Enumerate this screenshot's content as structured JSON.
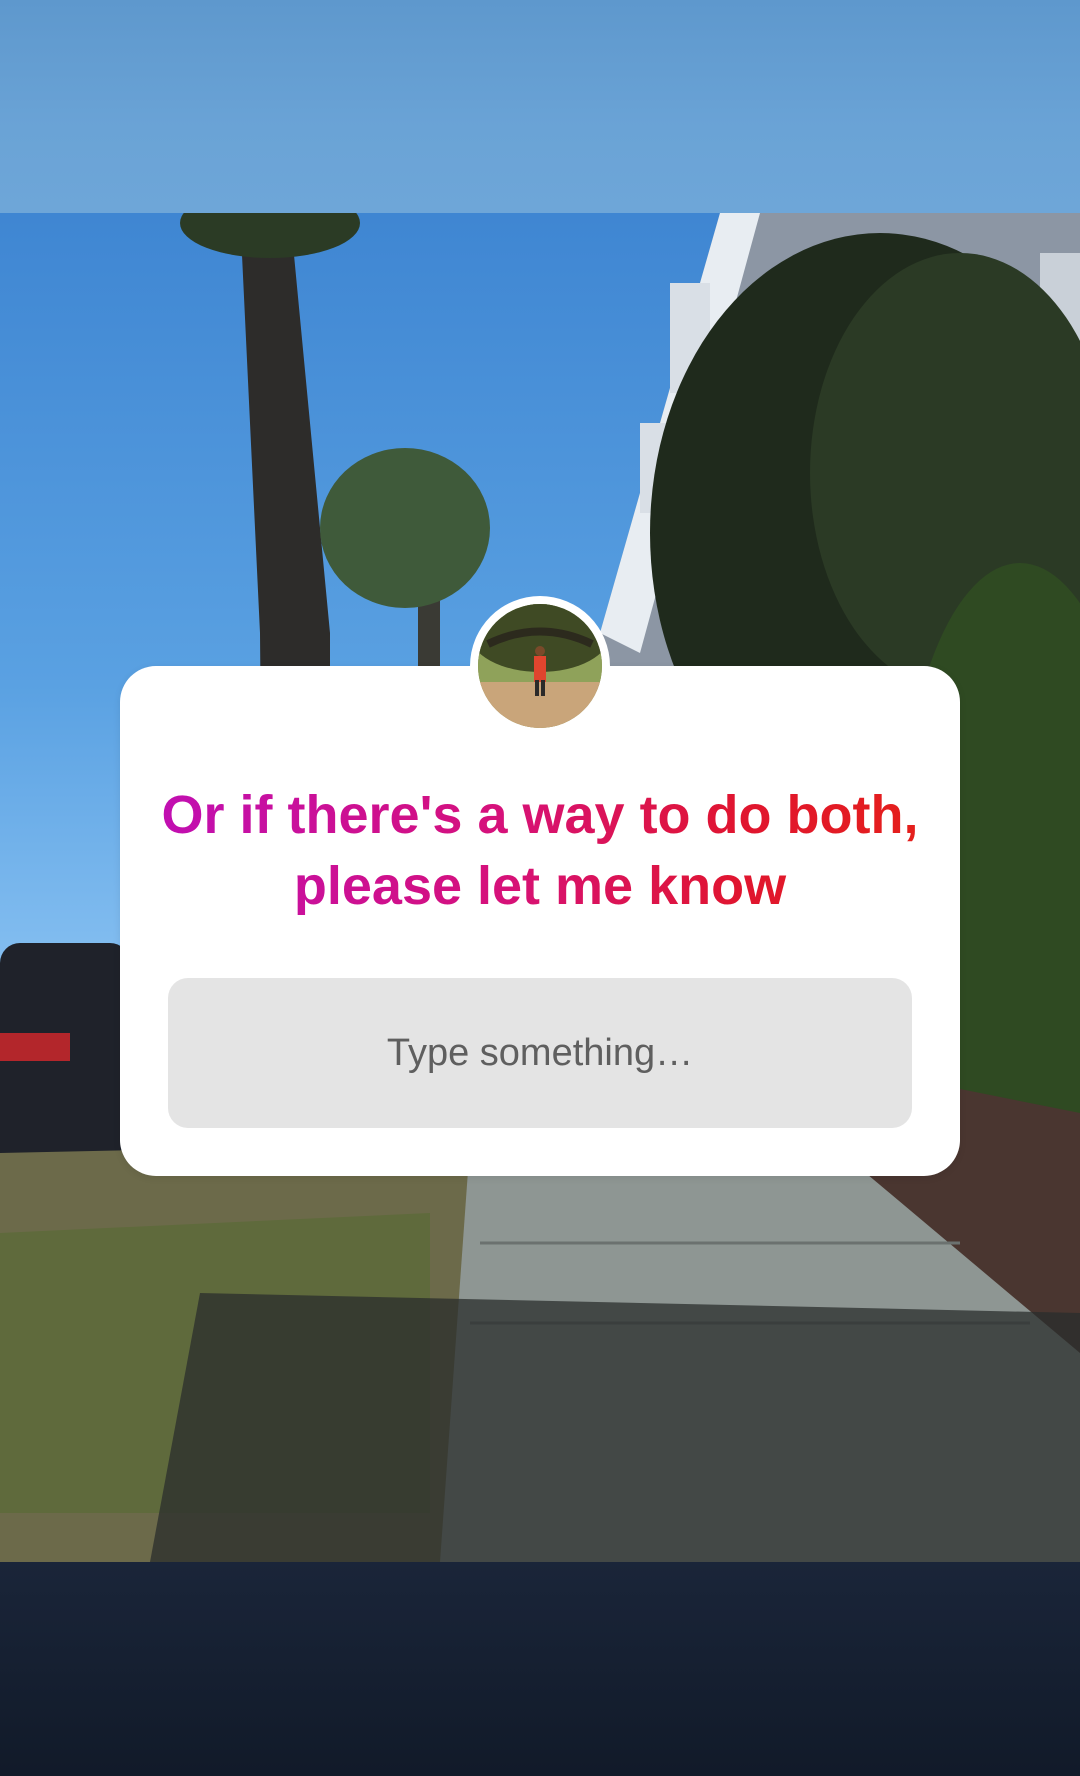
{
  "question_sticker": {
    "question_text": "Or if there's a way to do both, please let me know",
    "input_placeholder": "Type something…",
    "gradient_colors": [
      "#c00fb3",
      "#d6117a",
      "#e01530",
      "#e5201a"
    ]
  },
  "colors": {
    "top_band": "#6aa3d6",
    "bottom_band": "#141d2d",
    "card_background": "#ffffff",
    "input_background": "#e4e4e4",
    "placeholder_text": "#5f5f5f"
  },
  "icons": {
    "avatar": "profile-photo-avatar"
  }
}
